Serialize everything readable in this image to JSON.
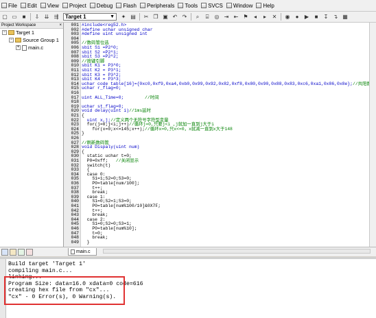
{
  "menu": [
    "File",
    "Edit",
    "View",
    "Project",
    "Debug",
    "Flash",
    "Peripherals",
    "Tools",
    "SVCS",
    "Window",
    "Help"
  ],
  "toolbar": {
    "target": "Target 1"
  },
  "workspace": {
    "title": "Project Workspace",
    "close": "×",
    "tree": [
      {
        "label": "Target 1",
        "level": 0
      },
      {
        "label": "Source Group 1",
        "level": 1
      },
      {
        "label": "main.c",
        "level": 2
      }
    ]
  },
  "editor": {
    "tab": "main.c",
    "lines": [
      [
        "001",
        "#include<reg52.h>",
        "kw"
      ],
      [
        "002",
        "#define uchar unsigned char",
        "kw"
      ],
      [
        "003",
        "#define uint unsigned int",
        "kw"
      ],
      [
        "004",
        "",
        ""
      ],
      [
        "005",
        "//数码管位选",
        "cm"
      ],
      [
        "006",
        "sbit S1 =P2^0;",
        ""
      ],
      [
        "007",
        "sbit S2 =P2^1;",
        ""
      ],
      [
        "008",
        "sbit S3 =P2^2;",
        ""
      ],
      [
        "009",
        "//按键引脚",
        "cm"
      ],
      [
        "010",
        "sbit K1 = P3^0;",
        ""
      ],
      [
        "011",
        "sbit K2 = P3^1;",
        ""
      ],
      [
        "012",
        "sbit K3 = P3^2;",
        ""
      ],
      [
        "013",
        "sbit K4 = P3^3;",
        ""
      ],
      [
        "014",
        "uchar code table[16]={0xc0,0xf9,0xa4,0xb0,0x99,0x92,0x82,0xf8,0x80,0x90,0x88,0x83,0xc6,0xa1,0x86,0x8e};//共阳数码管编码",
        ""
      ],
      [
        "015",
        "uchar r_flag=0;",
        ""
      ],
      [
        "016",
        "",
        ""
      ],
      [
        "017",
        "uint ALL_Time=0;        //时间",
        ""
      ],
      [
        "018",
        "",
        ""
      ],
      [
        "019",
        "uchar st_flag=0;",
        ""
      ],
      [
        "020",
        "void delay(uint i)//1ms延时",
        ""
      ],
      [
        "021",
        "{",
        ""
      ],
      [
        "022",
        "  uint x,j;//定义两个无符号字符型变量",
        ""
      ],
      [
        "023",
        "  for(j=0;j<i;j++)//循环j=0,只要j<i ,j就加一直到j大于i",
        ""
      ],
      [
        "024",
        "    for(x=0;x<=145;x++);//循环x=0,只x<=0，x就减一直到x大于148",
        ""
      ],
      [
        "025",
        "}",
        ""
      ],
      [
        "026",
        "",
        ""
      ],
      [
        "027",
        "//刷新数码管",
        "cm"
      ],
      [
        "028",
        "void Dispaly(uint num)",
        ""
      ],
      [
        "029",
        "{",
        ""
      ],
      [
        "030",
        "  static uchar t=0;",
        ""
      ],
      [
        "031",
        "  P0=0xff;   //关闭显示",
        ""
      ],
      [
        "032",
        "  switch(t)",
        ""
      ],
      [
        "033",
        "  {",
        ""
      ],
      [
        "034",
        "  case 0:",
        ""
      ],
      [
        "035",
        "    S1=1;S2=0;S3=0;",
        ""
      ],
      [
        "036",
        "    P0=table[num/100];",
        ""
      ],
      [
        "037",
        "    t++;",
        ""
      ],
      [
        "038",
        "    break;",
        ""
      ],
      [
        "039",
        "  case 1:",
        ""
      ],
      [
        "040",
        "    S1=0;S2=1;S3=0;",
        ""
      ],
      [
        "041",
        "    P0=table[num%100/10]&0X7F;",
        ""
      ],
      [
        "042",
        "    t++;",
        ""
      ],
      [
        "043",
        "    break;",
        ""
      ],
      [
        "044",
        "  case 2:",
        ""
      ],
      [
        "045",
        "    S1=0;S2=0;S3=1;",
        ""
      ],
      [
        "046",
        "    P0=table[num%10];",
        ""
      ],
      [
        "047",
        "    t=0;",
        ""
      ],
      [
        "048",
        "    break;",
        ""
      ],
      [
        "049",
        "  }",
        ""
      ]
    ]
  },
  "output": {
    "lines": [
      "Build target 'Target 1'",
      "compiling main.c...",
      "linking...",
      "Program Size: data=16.0 xdata=0 code=616",
      "creating hex file from \"cx\"...",
      "\"cx\" - 0 Error(s), 0 Warning(s)."
    ]
  }
}
